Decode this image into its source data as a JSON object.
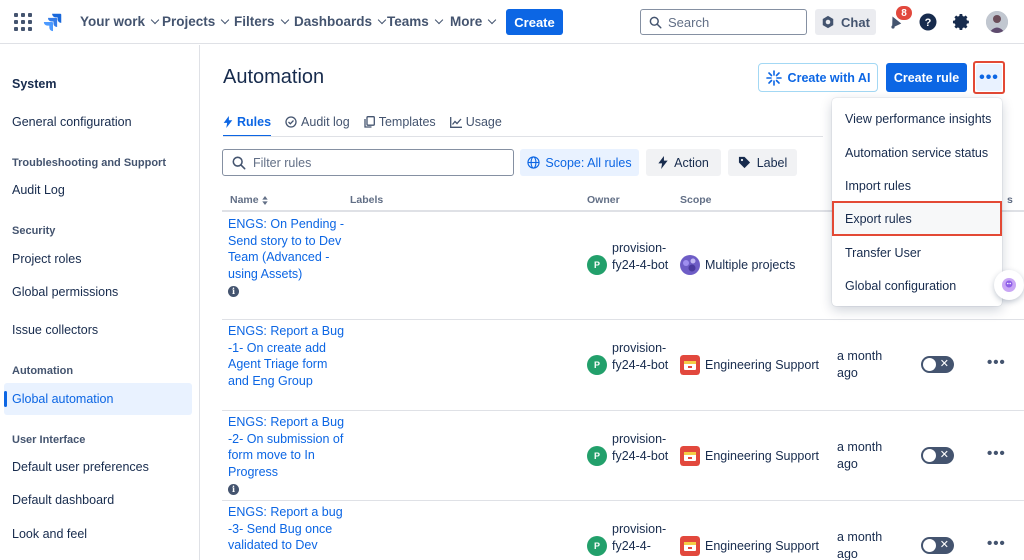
{
  "nav": {
    "items": [
      {
        "label": "Your work"
      },
      {
        "label": "Projects"
      },
      {
        "label": "Filters"
      },
      {
        "label": "Dashboards"
      },
      {
        "label": "Teams"
      },
      {
        "label": "More"
      }
    ],
    "create_label": "Create",
    "search_placeholder": "Search",
    "chat_label": "Chat",
    "notification_count": "8"
  },
  "sidebar": {
    "title": "System",
    "general_configuration": "General configuration",
    "sections": {
      "troubleshooting": "Troubleshooting and Support",
      "security": "Security",
      "automation": "Automation",
      "user_interface": "User Interface"
    },
    "items": {
      "audit_log": "Audit Log",
      "project_roles": "Project roles",
      "global_permissions": "Global permissions",
      "issue_collectors": "Issue collectors",
      "global_automation": "Global automation",
      "default_user_preferences": "Default user preferences",
      "default_dashboard": "Default dashboard",
      "look_and_feel": "Look and feel"
    }
  },
  "main": {
    "title": "Automation",
    "create_with_ai": "Create with AI",
    "create_rule": "Create rule",
    "more_label": "•••",
    "tabs": [
      {
        "label": "Rules"
      },
      {
        "label": "Audit log"
      },
      {
        "label": "Templates"
      },
      {
        "label": "Usage"
      }
    ],
    "filter_placeholder": "Filter rules",
    "scope_button": "Scope: All rules",
    "action_button": "Action",
    "label_button": "Label",
    "columns": {
      "name": "Name",
      "labels": "Labels",
      "owner": "Owner",
      "scope": "Scope",
      "partial_header": "s"
    },
    "rows": [
      {
        "name": "ENGS: On Pending - Send story to to Dev Team (Advanced - using Assets)",
        "owner_initial": "P",
        "owner": "provision-fy24-4-bot",
        "scope": "Multiple projects",
        "updated": ""
      },
      {
        "name": "ENGS: Report a Bug -1- On create add Agent Triage form and Eng Group",
        "owner_initial": "P",
        "owner": "provision-fy24-4-bot",
        "scope": "Engineering Support",
        "updated": "a month ago"
      },
      {
        "name": "ENGS: Report a Bug -2- On submission of form move to In Progress",
        "owner_initial": "P",
        "owner": "provision-fy24-4-bot",
        "scope": "Engineering Support",
        "updated": "a month ago"
      },
      {
        "name": "ENGS: Report a bug -3- Send Bug once validated to Dev",
        "owner_initial": "P",
        "owner": "provision-fy24-4-",
        "scope": "Engineering Support",
        "updated": "a month ago"
      }
    ],
    "toggle_x": "✕",
    "row_more": "•••",
    "info": "i"
  },
  "dropdown": {
    "items": [
      {
        "label": "View performance insights"
      },
      {
        "label": "Automation service status"
      },
      {
        "label": "Import rules"
      },
      {
        "label": "Export rules"
      },
      {
        "label": "Transfer User"
      },
      {
        "label": "Global configuration"
      }
    ]
  },
  "colors": {
    "brand_blue": "#0C66E4",
    "highlight_red": "#E34935",
    "owner_green": "#22A06B"
  }
}
